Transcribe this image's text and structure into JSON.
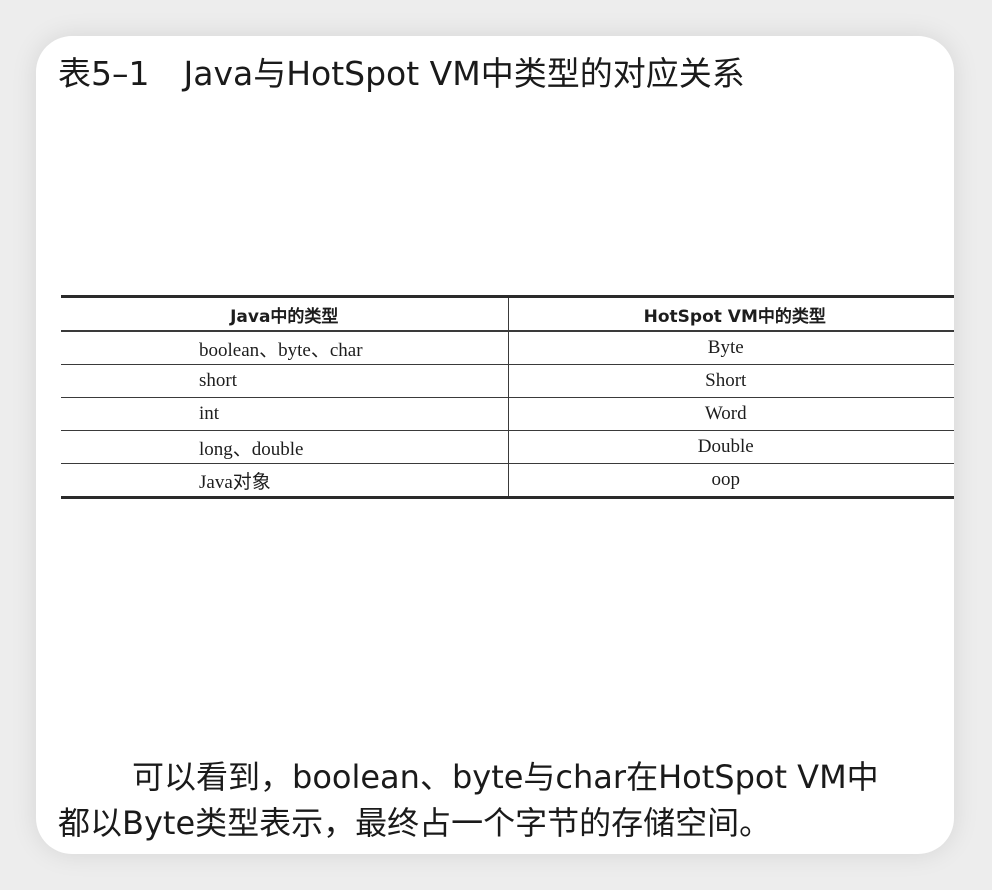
{
  "title": {
    "number": "表5–1",
    "text": "Java与HotSpot VM中类型的对应关系"
  },
  "table": {
    "headers": [
      "Java中的类型",
      "HotSpot VM中的类型"
    ],
    "rows": [
      [
        "boolean、byte、char",
        "Byte"
      ],
      [
        "short",
        "Short"
      ],
      [
        "int",
        "Word"
      ],
      [
        "long、double",
        "Double"
      ],
      [
        "Java对象",
        "oop"
      ]
    ]
  },
  "paragraph": {
    "line1": "可以看到，boolean、byte与char在HotSpot VM中",
    "line2": "都以Byte类型表示，最终占一个字节的存储空间。"
  }
}
